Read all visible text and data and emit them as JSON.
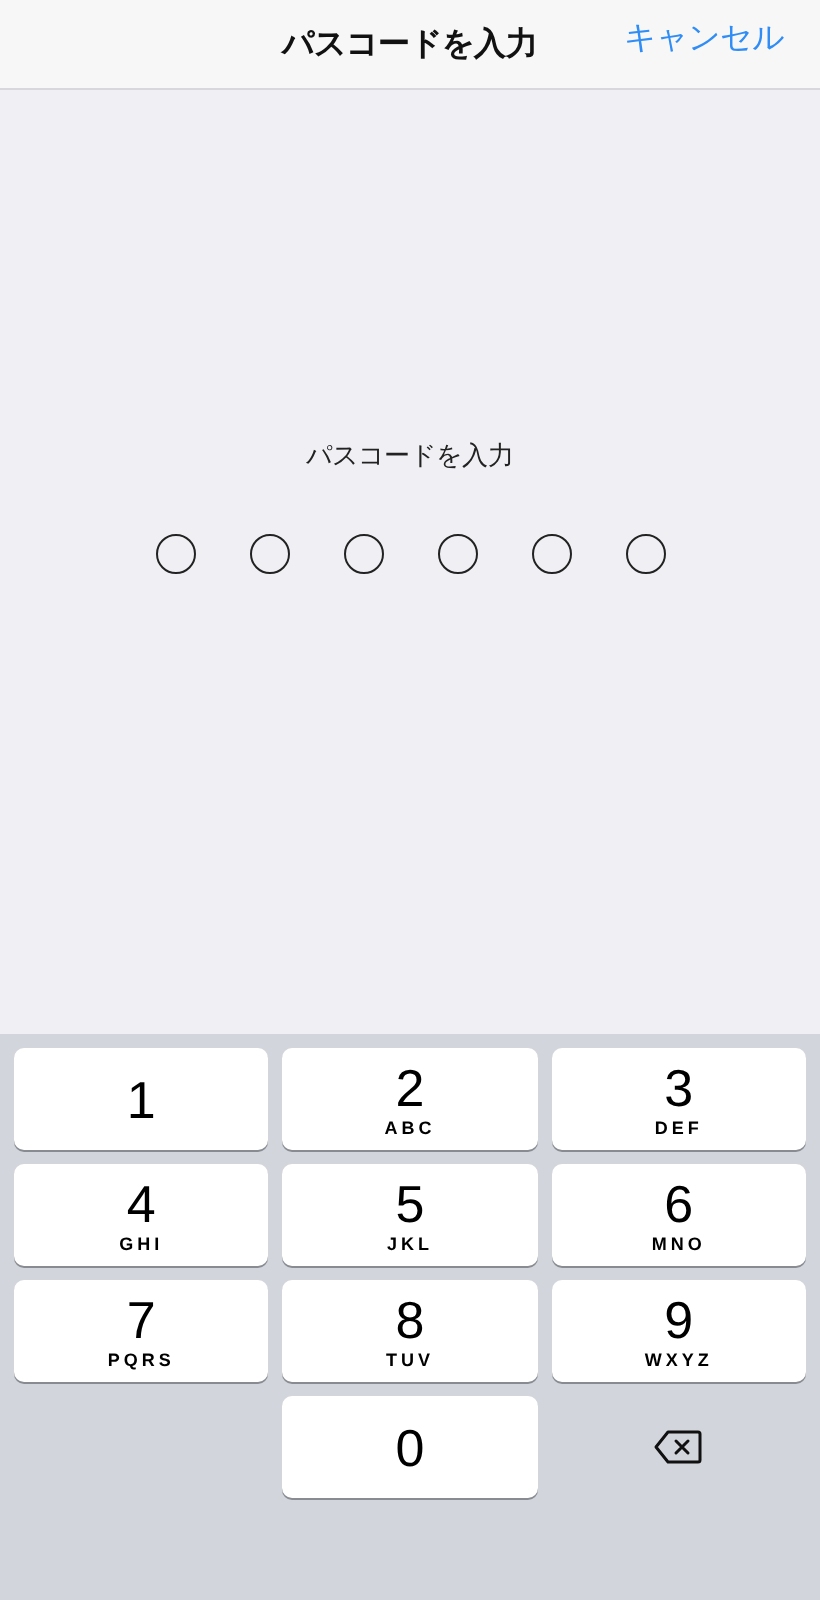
{
  "nav_bar": {
    "title": "パスコードを入力",
    "cancel": "キャンセル"
  },
  "prompt": "パスコードを入力",
  "passcode_dots": [
    {
      "filled": false
    },
    {
      "filled": false
    },
    {
      "filled": false
    },
    {
      "filled": false
    },
    {
      "filled": false
    },
    {
      "filled": false
    }
  ],
  "keypad": [
    {
      "kind": "digit",
      "digit": "1"
    },
    {
      "kind": "digit",
      "digit": "2",
      "letters": "ABC"
    },
    {
      "kind": "digit",
      "digit": "3",
      "letters": "DEF"
    },
    {
      "kind": "digit",
      "digit": "4",
      "letters": "GHI"
    },
    {
      "kind": "digit",
      "digit": "5",
      "letters": "JKL"
    },
    {
      "kind": "digit",
      "digit": "6",
      "letters": "MNO"
    },
    {
      "kind": "digit",
      "digit": "7",
      "letters": "PQRS"
    },
    {
      "kind": "digit",
      "digit": "8",
      "letters": "TUV"
    },
    {
      "kind": "digit",
      "digit": "9",
      "letters": "WXYZ"
    },
    {
      "kind": "blank"
    },
    {
      "kind": "digit",
      "digit": "0"
    },
    {
      "kind": "delete"
    }
  ]
}
